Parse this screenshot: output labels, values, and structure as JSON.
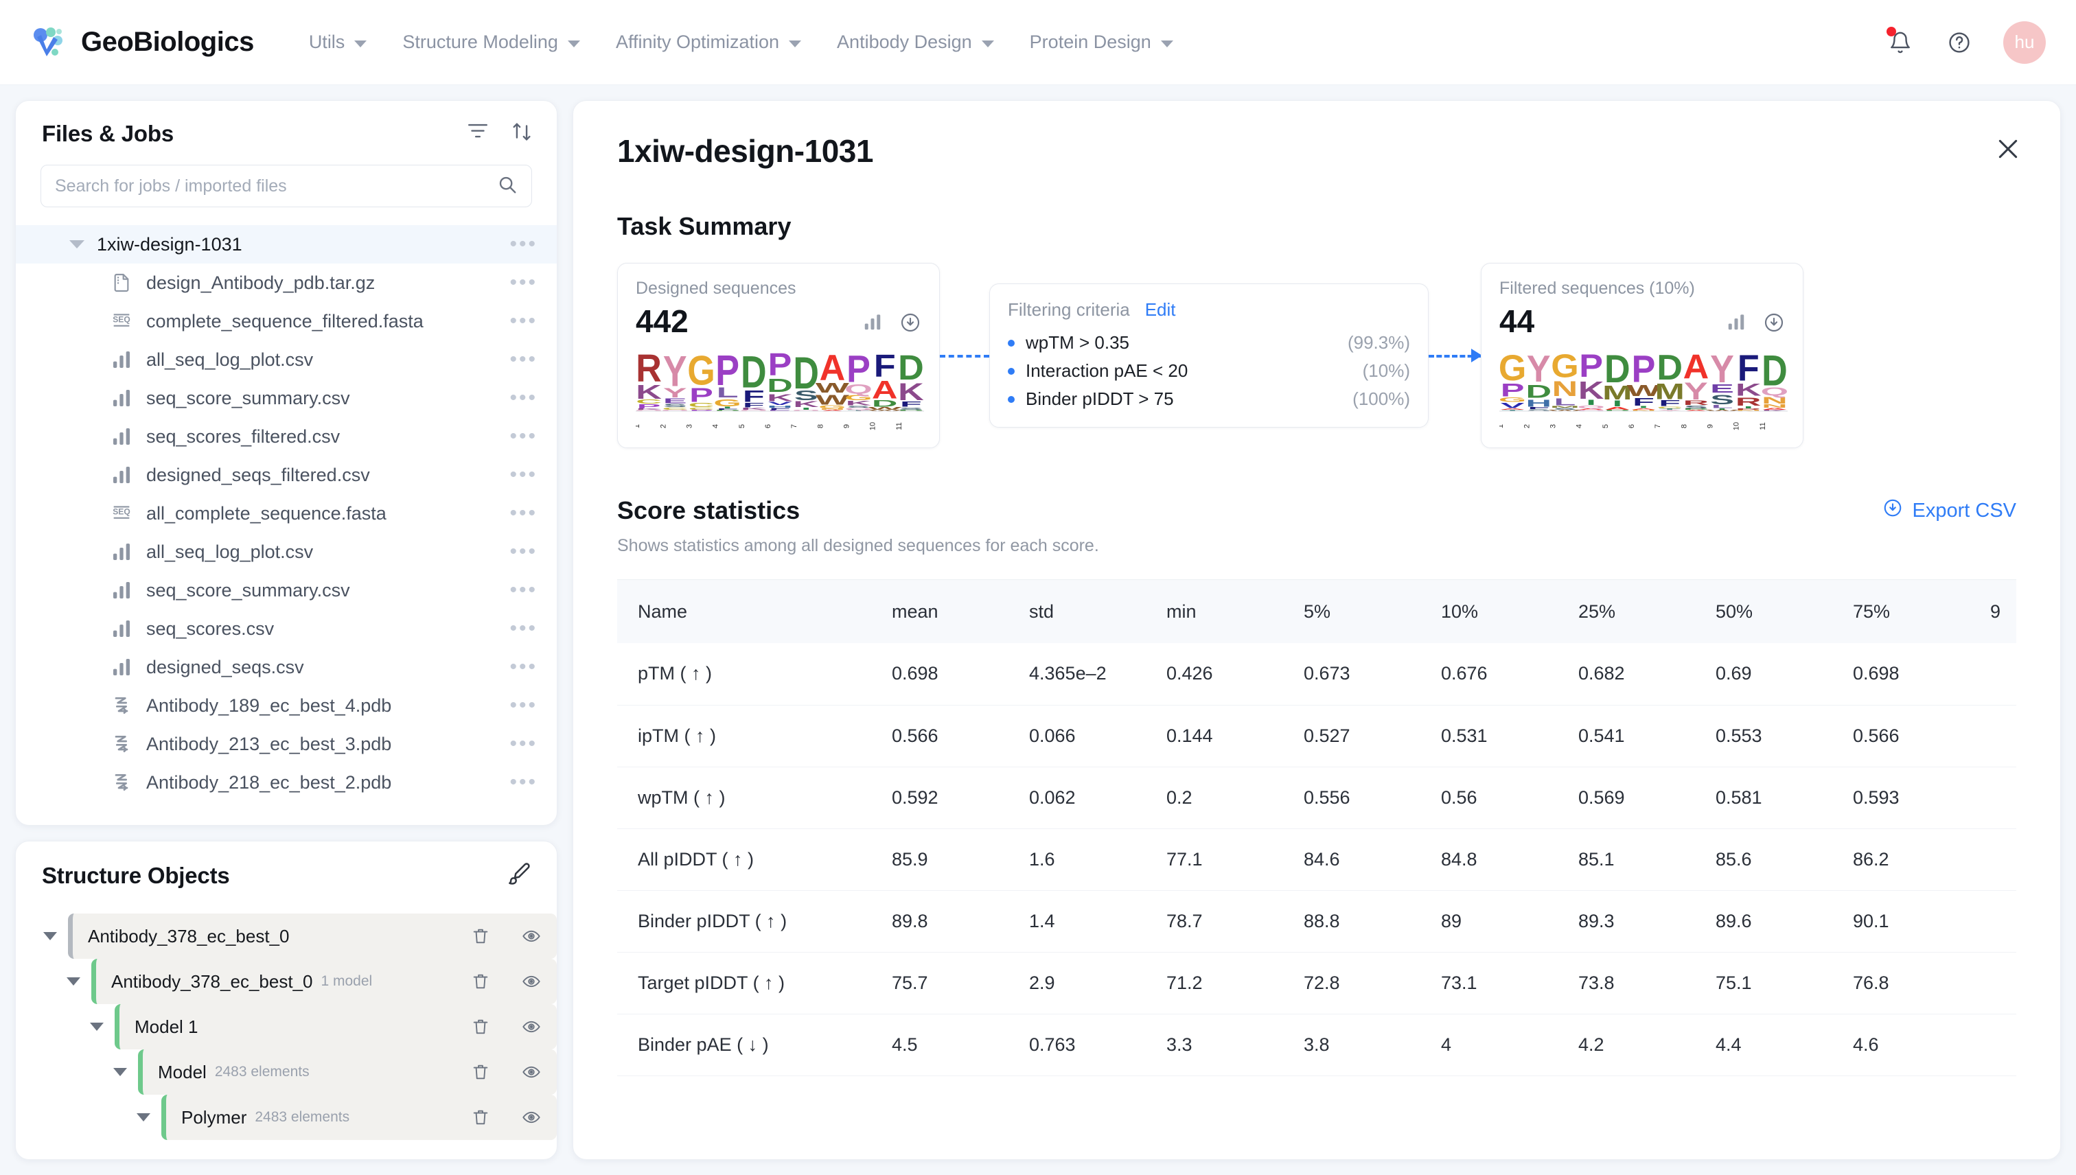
{
  "brand": {
    "name": "GeoBiologics",
    "logo_icon": "geo-logo-icon"
  },
  "nav": {
    "items": [
      {
        "label": "Utils",
        "icon": "chevron-down-icon"
      },
      {
        "label": "Structure Modeling",
        "icon": "chevron-down-icon"
      },
      {
        "label": "Affinity Optimization",
        "icon": "chevron-down-icon"
      },
      {
        "label": "Antibody Design",
        "icon": "chevron-down-icon"
      },
      {
        "label": "Protein Design",
        "icon": "chevron-down-icon"
      }
    ],
    "right": {
      "notifications_icon": "bell-icon",
      "help_icon": "question-circle-icon",
      "avatar_initials": "hu"
    }
  },
  "files_panel": {
    "title": "Files & Jobs",
    "filter_icon": "filter-icon",
    "sort_icon": "sort-transfer-icon",
    "search": {
      "value": "",
      "placeholder": "Search for jobs / imported files",
      "icon": "search-icon"
    },
    "root": {
      "label": "1xiw-design-1031",
      "icon": "chevron-down-icon",
      "menu_icon": "more-horizontal-icon"
    },
    "items": [
      {
        "label": "design_Antibody_pdb.tar.gz",
        "icon": "archive-file-icon"
      },
      {
        "label": "complete_sequence_filtered.fasta",
        "icon": "seq-file-icon"
      },
      {
        "label": "all_seq_log_plot.csv",
        "icon": "chart-file-icon"
      },
      {
        "label": "seq_score_summary.csv",
        "icon": "chart-file-icon"
      },
      {
        "label": "seq_scores_filtered.csv",
        "icon": "chart-file-icon"
      },
      {
        "label": "designed_seqs_filtered.csv",
        "icon": "chart-file-icon"
      },
      {
        "label": "all_complete_sequence.fasta",
        "icon": "seq-file-icon"
      },
      {
        "label": "all_seq_log_plot.csv",
        "icon": "chart-file-icon"
      },
      {
        "label": "seq_score_summary.csv",
        "icon": "chart-file-icon"
      },
      {
        "label": "seq_scores.csv",
        "icon": "chart-file-icon"
      },
      {
        "label": "designed_seqs.csv",
        "icon": "chart-file-icon"
      },
      {
        "label": "Antibody_189_ec_best_4.pdb",
        "icon": "structure-file-icon"
      },
      {
        "label": "Antibody_213_ec_best_3.pdb",
        "icon": "structure-file-icon"
      },
      {
        "label": "Antibody_218_ec_best_2.pdb",
        "icon": "structure-file-icon"
      }
    ]
  },
  "structure_panel": {
    "title": "Structure Objects",
    "tool_icon": "paint-brush-icon",
    "rows": [
      {
        "name": "Antibody_378_ec_best_0",
        "sub": "",
        "indent": 0,
        "accent": "#b3b8bf"
      },
      {
        "name": "Antibody_378_ec_best_0",
        "sub": "1 model",
        "indent": 1,
        "accent": "#6ec98b"
      },
      {
        "name": "Model 1",
        "sub": "",
        "indent": 2,
        "accent": "#6ec98b"
      },
      {
        "name": "Model",
        "sub": "2483 elements",
        "indent": 3,
        "accent": "#6ec98b"
      },
      {
        "name": "Polymer",
        "sub": "2483 elements",
        "indent": 4,
        "accent": "#6ec98b"
      }
    ],
    "delete_icon": "trash-icon",
    "visibility_icon": "eye-icon"
  },
  "main": {
    "title": "1xiw-design-1031",
    "close_icon": "close-icon",
    "task_summary_title": "Task Summary",
    "designed": {
      "label": "Designed sequences",
      "count": "442",
      "chart_icon": "bar-chart-icon",
      "download_icon": "download-icon"
    },
    "criteria": {
      "title": "Filtering criteria",
      "edit_label": "Edit",
      "rows": [
        {
          "text": "wpTM > 0.35",
          "pct": "(99.3%)"
        },
        {
          "text": "Interaction pAE < 20",
          "pct": "(10%)"
        },
        {
          "text": "Binder pIDDT > 75",
          "pct": "(100%)"
        }
      ]
    },
    "filtered": {
      "label": "Filtered sequences (10%)",
      "count": "44",
      "chart_icon": "bar-chart-icon",
      "download_icon": "download-icon"
    },
    "score": {
      "title": "Score statistics",
      "subtitle": "Shows statistics among all designed sequences for each score.",
      "export_label": "Export CSV",
      "export_icon": "download-icon"
    }
  },
  "chart_data": {
    "type": "table",
    "title": "Score statistics",
    "columns": [
      "Name",
      "mean",
      "std",
      "min",
      "5%",
      "10%",
      "25%",
      "50%",
      "75%",
      "9"
    ],
    "rows": [
      {
        "cells": [
          "pTM ( ↑ )",
          "0.698",
          "4.365e–2",
          "0.426",
          "0.673",
          "0.676",
          "0.682",
          "0.69",
          "0.698",
          ""
        ]
      },
      {
        "cells": [
          "ipTM ( ↑ )",
          "0.566",
          "0.066",
          "0.144",
          "0.527",
          "0.531",
          "0.541",
          "0.553",
          "0.566",
          ""
        ]
      },
      {
        "cells": [
          "wpTM ( ↑ )",
          "0.592",
          "0.062",
          "0.2",
          "0.556",
          "0.56",
          "0.569",
          "0.581",
          "0.593",
          ""
        ]
      },
      {
        "cells": [
          "All pIDDT ( ↑ )",
          "85.9",
          "1.6",
          "77.1",
          "84.6",
          "84.8",
          "85.1",
          "85.6",
          "86.2",
          ""
        ]
      },
      {
        "cells": [
          "Binder pIDDT ( ↑ )",
          "89.8",
          "1.4",
          "78.7",
          "88.8",
          "89",
          "89.3",
          "89.6",
          "90.1",
          ""
        ]
      },
      {
        "cells": [
          "Target pIDDT ( ↑ )",
          "75.7",
          "2.9",
          "71.2",
          "72.8",
          "73.1",
          "73.8",
          "75.1",
          "76.8",
          ""
        ]
      },
      {
        "cells": [
          "Binder pAE ( ↓ )",
          "4.5",
          "0.763",
          "3.3",
          "3.8",
          "4",
          "4.2",
          "4.4",
          "4.6",
          ""
        ]
      }
    ],
    "logo_designed": {
      "type": "sequence-logo",
      "positions": [
        "1",
        "2",
        "3",
        "4",
        "5",
        "6",
        "7",
        "8",
        "9",
        "10",
        "11"
      ],
      "top_letters": [
        "R",
        "Y",
        "G",
        "P",
        "D",
        "P",
        "D",
        "A",
        "P",
        "F",
        "D"
      ]
    },
    "logo_filtered": {
      "type": "sequence-logo",
      "positions": [
        "1",
        "2",
        "3",
        "4",
        "5",
        "6",
        "7",
        "8",
        "9",
        "10",
        "11"
      ],
      "top_letters": [
        "G",
        "Y",
        "G",
        "P",
        "D",
        "P",
        "D",
        "A",
        "Y",
        "F",
        "D"
      ]
    },
    "colors": {
      "accent": "#2f7cf6",
      "green": "#6ec98b",
      "red": "#f5222d"
    }
  }
}
